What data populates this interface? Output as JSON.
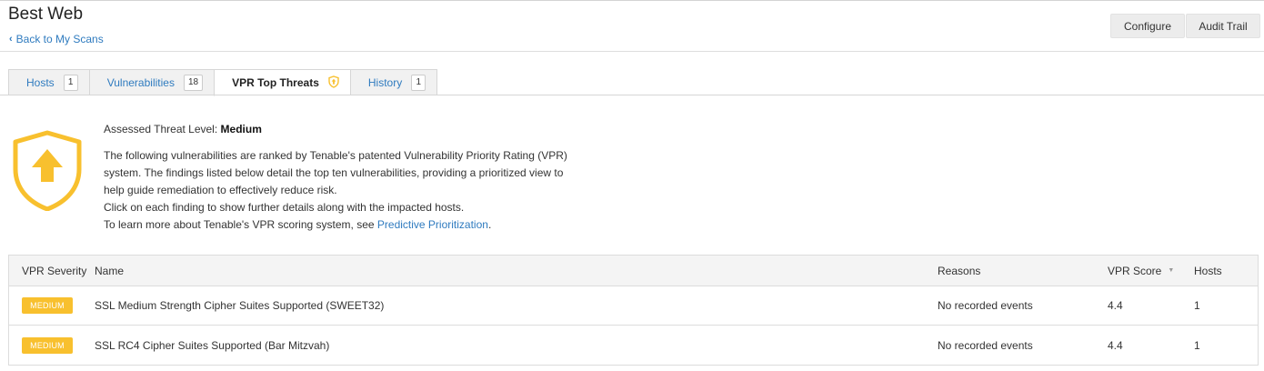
{
  "header": {
    "title": "Best Web",
    "back_label": "Back to My Scans",
    "configure_label": "Configure",
    "audit_label": "Audit Trail"
  },
  "tabs": [
    {
      "label": "Hosts",
      "count": "1"
    },
    {
      "label": "Vulnerabilities",
      "count": "18"
    },
    {
      "label": "VPR Top Threats",
      "icon": "shield-icon"
    },
    {
      "label": "History",
      "count": "1"
    }
  ],
  "threat": {
    "level_label": "Assessed Threat Level:",
    "level_value": "Medium",
    "accent_color": "#f8c02e",
    "description_lines": [
      "The following vulnerabilities are ranked by Tenable's patented Vulnerability Priority Rating (VPR)",
      "system. The findings listed below detail the top ten vulnerabilities, providing a prioritized view to",
      "help guide remediation to effectively reduce risk.",
      "Click on each finding to show further details along with the impacted hosts."
    ],
    "learn_more_prefix": "To learn more about Tenable's VPR scoring system, see ",
    "learn_more_link": "Predictive Prioritization",
    "learn_more_suffix": "."
  },
  "table": {
    "columns": {
      "severity": "VPR Severity",
      "name": "Name",
      "reasons": "Reasons",
      "score": "VPR Score",
      "hosts": "Hosts"
    },
    "rows": [
      {
        "severity": "MEDIUM",
        "name": "SSL Medium Strength Cipher Suites Supported (SWEET32)",
        "reasons": "No recorded events",
        "score": "4.4",
        "hosts": "1"
      },
      {
        "severity": "MEDIUM",
        "name": "SSL RC4 Cipher Suites Supported (Bar Mitzvah)",
        "reasons": "No recorded events",
        "score": "4.4",
        "hosts": "1"
      }
    ]
  }
}
